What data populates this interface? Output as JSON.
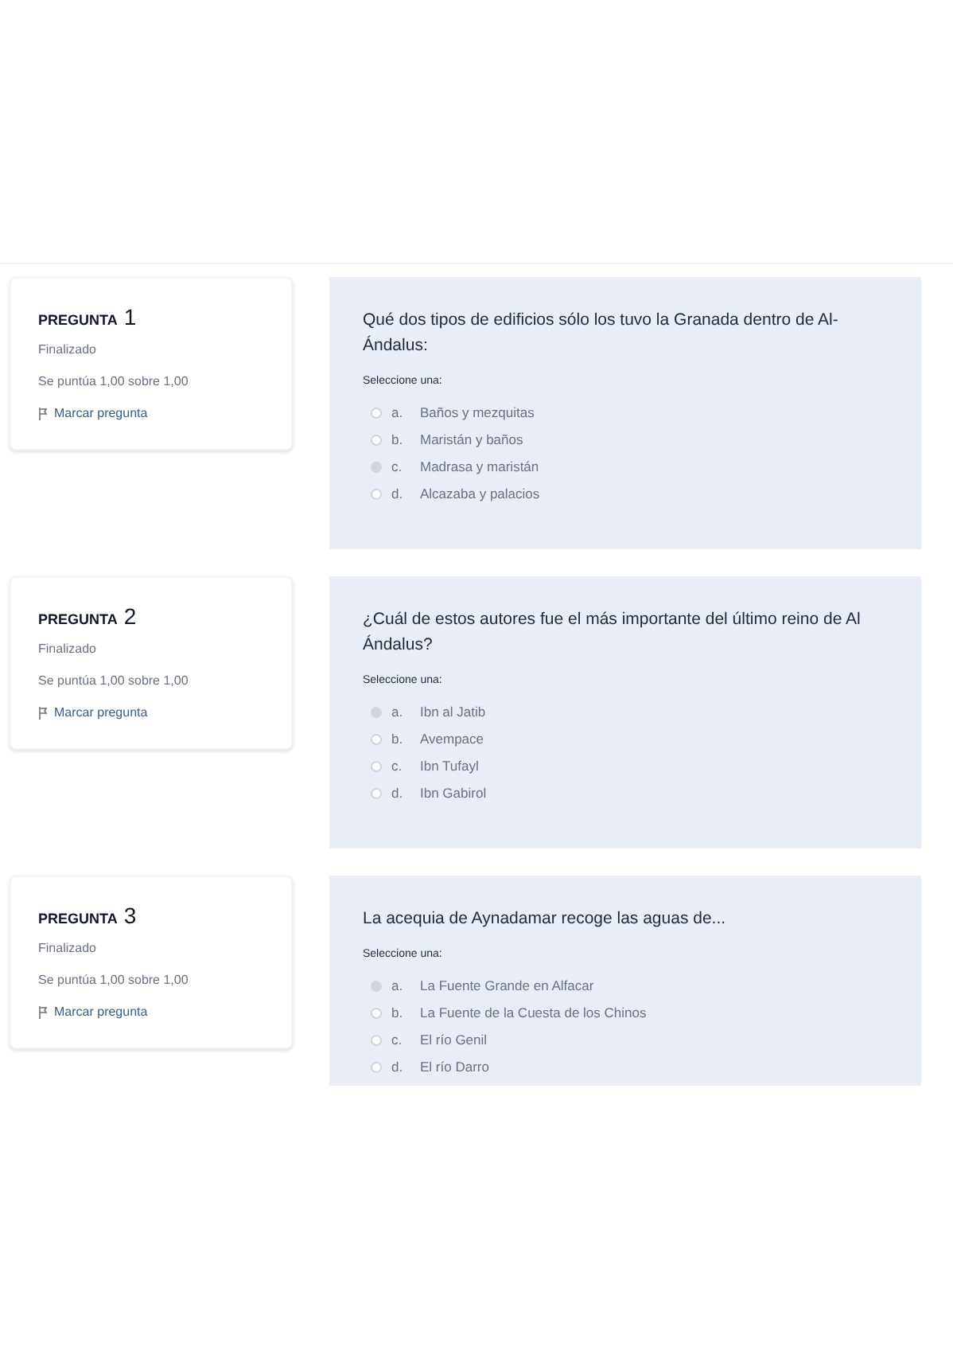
{
  "questions": [
    {
      "label": "PREGUNTA",
      "number": "1",
      "status": "Finalizado",
      "score": "Se puntúa 1,00 sobre 1,00",
      "flag": "Marcar pregunta",
      "text": "Qué dos tipos de edificios sólo los tuvo la Granada dentro de Al-Ándalus:",
      "prompt": "Seleccione una:",
      "options": [
        {
          "letter": "a.",
          "label": "Baños y mezquitas",
          "selected": false
        },
        {
          "letter": "b.",
          "label": "Maristán y baños",
          "selected": false
        },
        {
          "letter": "c.",
          "label": "Madrasa y maristán",
          "selected": true
        },
        {
          "letter": "d.",
          "label": "Alcazaba y palacios",
          "selected": false
        }
      ]
    },
    {
      "label": "PREGUNTA",
      "number": "2",
      "status": "Finalizado",
      "score": "Se puntúa 1,00 sobre 1,00",
      "flag": "Marcar pregunta",
      "text": "¿Cuál de estos autores fue el más importante del último reino de Al Ándalus?",
      "prompt": "Seleccione una:",
      "options": [
        {
          "letter": "a.",
          "label": "Ibn al Jatib",
          "selected": true
        },
        {
          "letter": "b.",
          "label": "Avempace",
          "selected": false
        },
        {
          "letter": "c.",
          "label": "Ibn Tufayl",
          "selected": false
        },
        {
          "letter": "d.",
          "label": "Ibn Gabirol",
          "selected": false
        }
      ]
    },
    {
      "label": "PREGUNTA",
      "number": "3",
      "status": "Finalizado",
      "score": "Se puntúa 1,00 sobre 1,00",
      "flag": "Marcar pregunta",
      "text": "La acequia de Aynadamar recoge las aguas de...",
      "prompt": "Seleccione una:",
      "options": [
        {
          "letter": "a.",
          "label": "La Fuente Grande en Alfacar",
          "selected": true
        },
        {
          "letter": "b.",
          "label": "La Fuente de la Cuesta de los Chinos",
          "selected": false
        },
        {
          "letter": "c.",
          "label": "El río Genil",
          "selected": false
        },
        {
          "letter": "d.",
          "label": "El río Darro",
          "selected": false
        }
      ]
    }
  ]
}
